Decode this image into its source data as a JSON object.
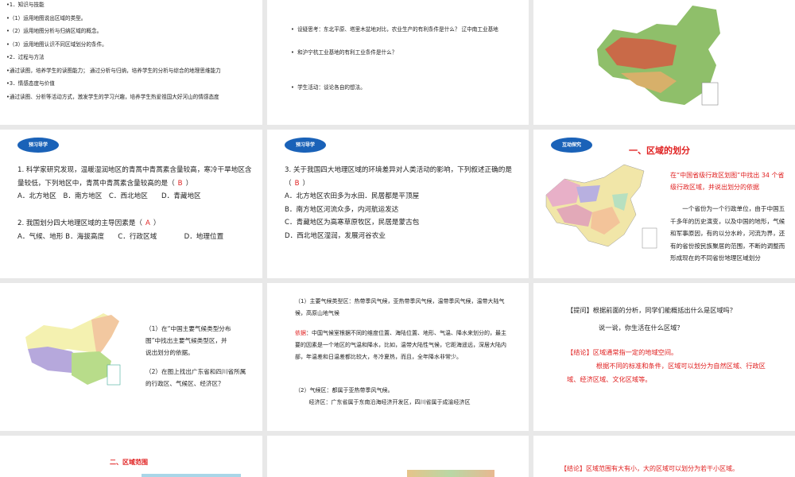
{
  "slide1": {
    "lines": [
      "•1．知识与技能",
      "•（1）运用地图说出区域的类型。",
      "•（2）运用地图分析与归纳区域的概念。",
      "•（3）运用地图认识不同区域划分的条件。",
      "•2．过程与方法",
      "•通过读图，培养学生的读图能力； 通过分析与归纳，培养学生的分析与综合的地理思维能力",
      "•3．情感态度与价值",
      "•通过读图、分析等活动方式，激发学生的学习兴趣，培养学生热爱祖国大好河山的情感态度"
    ]
  },
  "slide2": {
    "bullets": [
      "设疑思考：东北平原、塔里木盆地对比，农业生产的有利条件是什么？ 辽中南工业基地",
      "和沪宁杭工业基地的有利工业条件是什么？",
      "学生活动：谈论各自的想法。"
    ]
  },
  "slide4": {
    "badge": "预习导学",
    "q1": "1. 科学家研究发现，温暖湿润地区的青蒿中青蒿素含量较高，寒冷干旱地区含量较低，下列地区中，青蒿中青蒿素含量较高的是（",
    "q1_answer": "B",
    "q1_close": "）",
    "q1_options": "A．北方地区　B．南方地区　C．西北地区　　D．青藏地区",
    "q2": "2. 我国划分四大地理区域的主导因素是（",
    "q2_answer": "A",
    "q2_close": "）",
    "q2_options": "A．气候、地形 B．海拔高度　　C．行政区域　　　　D．地理位置"
  },
  "slide5": {
    "badge": "预习导学",
    "q3": "3. 关于我国四大地理区域的环境差异对人类活动的影响，下列叙述正确的是（",
    "q3_answer": "B",
    "q3_close": "）",
    "options": [
      "A．北方地区农田多为水田．民居都是平顶屋",
      "B．南方地区河流众多，内河航运发达",
      "C．青藏地区为高寒草原牧区，民居是蒙古包",
      "D．西北地区湿润，发展河谷农业"
    ]
  },
  "slide6": {
    "badge": "互动探究",
    "title": "一、区域的划分",
    "prompt": "在“中国省级行政区划图”中找出 34 个省级行政区域，并说出划分的依据",
    "body": "一个省份为一个行政单位，由于中国五千多年的历史演变，以及中国的地形，气候和军事原因，有的以分水岭，河流为界，还有的省份按民族聚居的范围，不断的调整而形成现在的不同省份地理区域划分"
  },
  "slide7": {
    "q1": "（1）在“中国主要气候类型分布图”中找出主要气候类型区，并说出划分的依据。",
    "q2": "（2）在图上找出广东省和四川省所属的行政区、气候区、经济区？"
  },
  "slide8": {
    "p1": "（1）主要气候类型区：热带季风气候，亚热带季风气候，温带季风气候，温带大陆气候，高原山地气候",
    "basis_label": "依据",
    "basis": "：中国气候室根据不同的维度位置、海陆位置、地形、气温、降水来划分的，最主要的因素是一个地区的气温和降水，比如，温带大陆性气候，它距海遥远，深居大陆内部，年温差和日温差都比较大，冬冷夏热，而且，全年降水非常少。",
    "p2": "（2）气候区：都属于亚热带季风气候。",
    "p3": "经济区：广东省属于东南沿海经济开发区，四川省属于成渝经济区"
  },
  "slide9": {
    "ask": "【提问】根据前面的分析，同学们能概括出什么是区域吗？",
    "ask2": "说一说，你生活在什么区域？",
    "c1": "【结论】区域通常指一定的地域空间。",
    "c2": "根据不同的标准和条件，区域可以划分为自然区域、行政区域、经济区域、文化区域等。"
  },
  "slide10": {
    "title": "二、区域范围"
  },
  "slide12": {
    "text": "【结论】区域范围有大有小，大的区域可以划分为若干小区域。"
  }
}
